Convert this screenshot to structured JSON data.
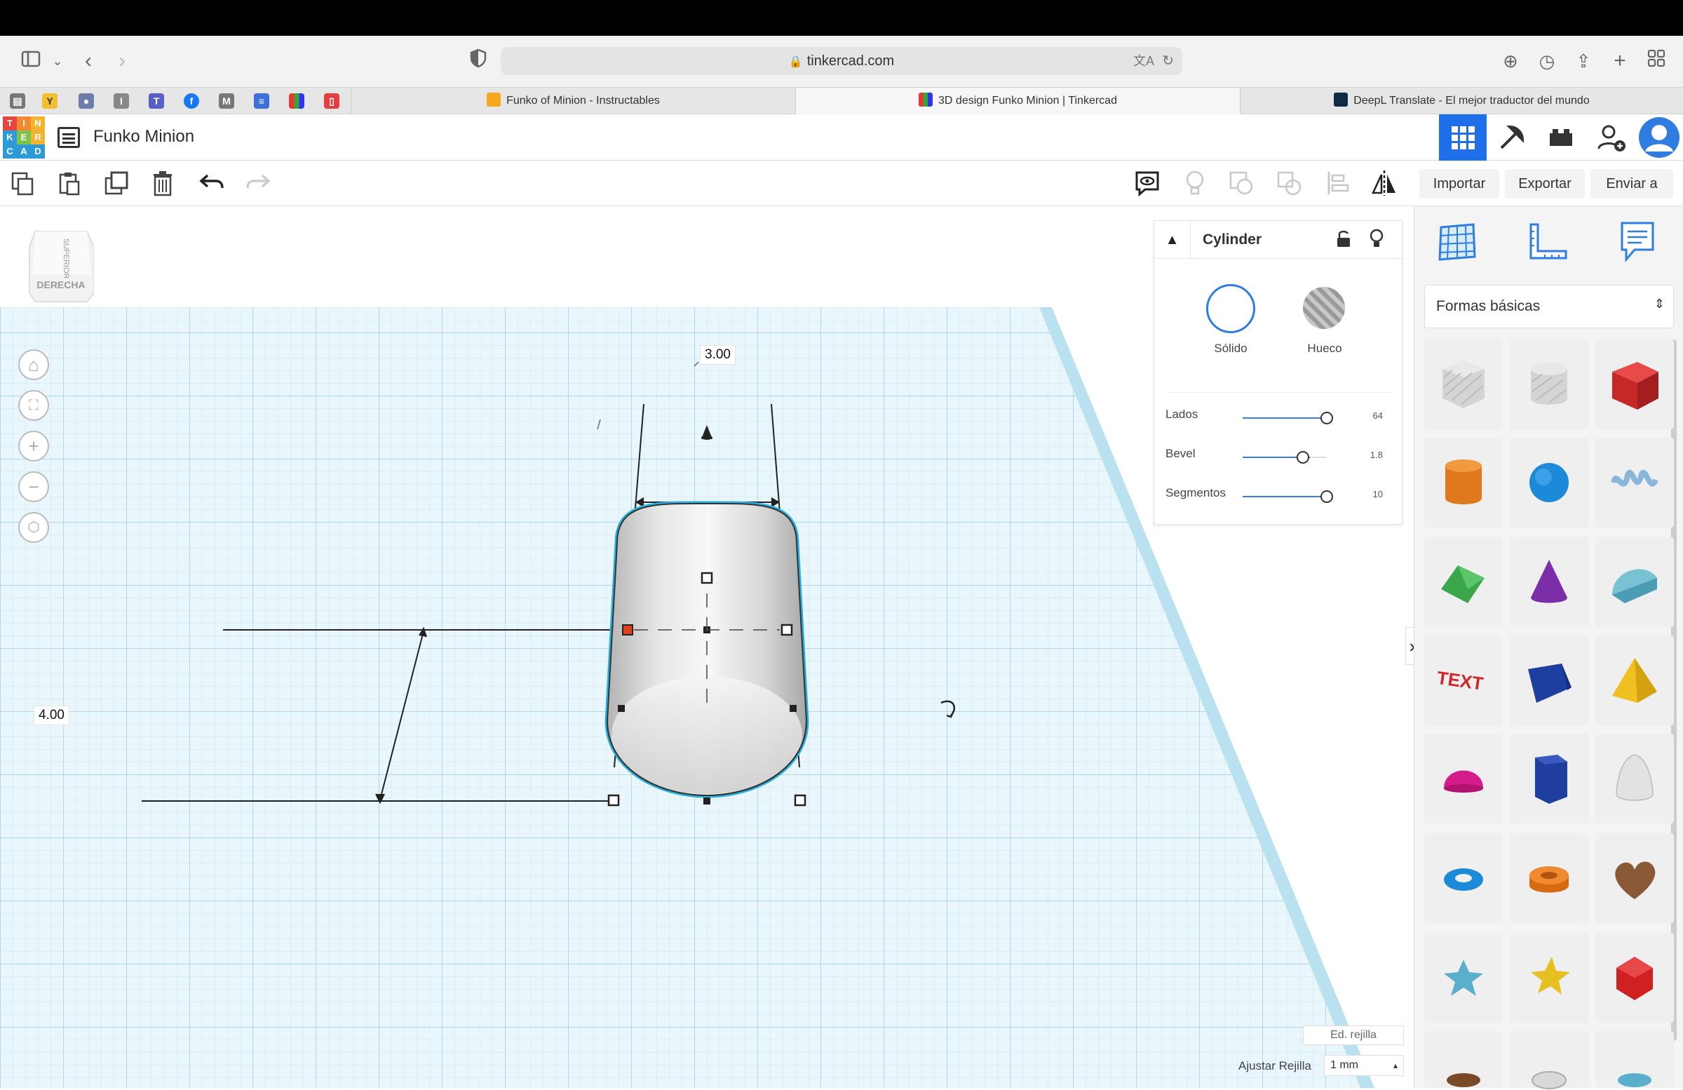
{
  "browser": {
    "url": "tinkercad.com",
    "tabs": [
      {
        "label": "Funko of Minion - Instructables",
        "active": false
      },
      {
        "label": "3D design Funko Minion | Tinkercad",
        "active": true
      },
      {
        "label": "DeepL Translate - El mejor traductor del mundo",
        "active": false
      }
    ]
  },
  "app": {
    "logo_letters": [
      "T",
      "I",
      "N",
      "K",
      "E",
      "R",
      "C",
      "A",
      "D"
    ],
    "project_title": "Funko Minion",
    "actions": {
      "import": "Importar",
      "export": "Exportar",
      "send": "Enviar a"
    }
  },
  "viewcube": {
    "top": "SUPERIOR",
    "right": "DERECHA"
  },
  "dimensions": {
    "width": "3.00",
    "depth": "4.00"
  },
  "inspector": {
    "shape_name": "Cylinder",
    "solid_label": "Sólido",
    "hole_label": "Hueco",
    "params": [
      {
        "label": "Lados",
        "value": "64",
        "fraction": 1.0
      },
      {
        "label": "Bevel",
        "value": "1.8",
        "fraction": 0.8
      },
      {
        "label": "Segmentos",
        "value": "10",
        "fraction": 1.0
      }
    ]
  },
  "library": {
    "category": "Formas básicas",
    "shapes": [
      "box-hole",
      "cylinder-hole",
      "box",
      "cylinder",
      "sphere",
      "scribble",
      "roof",
      "cone",
      "round-roof",
      "text",
      "wedge",
      "pyramid",
      "half-sphere",
      "polygon",
      "paraboloid",
      "torus",
      "tube",
      "heart",
      "star",
      "star-yellow",
      "icosahedron"
    ]
  },
  "grid": {
    "edit_label": "Ed. rejilla",
    "snap_label": "Ajustar Rejilla",
    "snap_value": "1 mm"
  },
  "colors": {
    "accent": "#1f6feb",
    "grid_bg": "#e6f4fa",
    "grid_line": "#b9dceb",
    "selection": "#2ab0e0"
  }
}
